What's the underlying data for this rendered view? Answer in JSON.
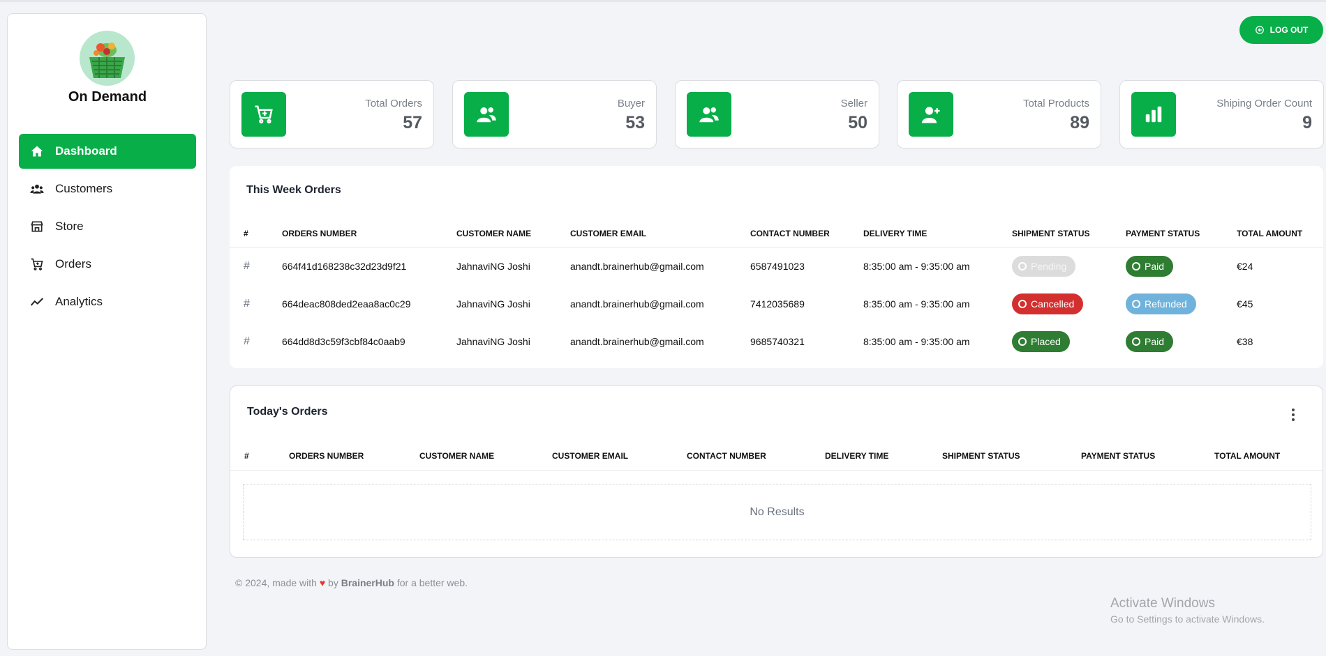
{
  "app": {
    "brand": "On Demand",
    "logout_label": "LOG OUT"
  },
  "colors": {
    "accent": "#08ae48",
    "pending": "#d9d9d9",
    "cancelled": "#d32f2f",
    "refunded": "#6fb3dc",
    "placed_paid": "#2e7d32"
  },
  "sidebar": {
    "items": [
      {
        "label": "Dashboard",
        "icon": "home-icon",
        "active": true
      },
      {
        "label": "Customers",
        "icon": "users-icon"
      },
      {
        "label": "Store",
        "icon": "store-icon"
      },
      {
        "label": "Orders",
        "icon": "cart-icon"
      },
      {
        "label": "Analytics",
        "icon": "trend-icon"
      }
    ]
  },
  "stats": [
    {
      "label": "Total Orders",
      "value": "57",
      "icon": "cart-plus-icon"
    },
    {
      "label": "Buyer",
      "value": "53",
      "icon": "users-icon"
    },
    {
      "label": "Seller",
      "value": "50",
      "icon": "users-icon"
    },
    {
      "label": "Total Products",
      "value": "89",
      "icon": "user-plus-icon"
    },
    {
      "label": "Shiping Order Count",
      "value": "9",
      "icon": "bar-chart-icon"
    }
  ],
  "week_orders": {
    "title": "This Week Orders",
    "columns": [
      "#",
      "ORDERS NUMBER",
      "CUSTOMER NAME",
      "CUSTOMER EMAIL",
      "CONTACT NUMBER",
      "DELIVERY TIME",
      "SHIPMENT STATUS",
      "PAYMENT STATUS",
      "TOTAL AMOUNT"
    ],
    "rows": [
      {
        "hash": "#",
        "order": "664f41d168238c32d23d9f21",
        "name": "JahnaviNG Joshi",
        "email": "anandt.brainerhub@gmail.com",
        "contact": "6587491023",
        "time": "8:35:00 am - 9:35:00 am",
        "shipment": "Pending",
        "payment": "Paid",
        "amount": "€24"
      },
      {
        "hash": "#",
        "order": "664deac808ded2eaa8ac0c29",
        "name": "JahnaviNG Joshi",
        "email": "anandt.brainerhub@gmail.com",
        "contact": "7412035689",
        "time": "8:35:00 am - 9:35:00 am",
        "shipment": "Cancelled",
        "payment": "Refunded",
        "amount": "€45"
      },
      {
        "hash": "#",
        "order": "664dd8d3c59f3cbf84c0aab9",
        "name": "JahnaviNG Joshi",
        "email": "anandt.brainerhub@gmail.com",
        "contact": "9685740321",
        "time": "8:35:00 am - 9:35:00 am",
        "shipment": "Placed",
        "payment": "Paid",
        "amount": "€38"
      }
    ]
  },
  "today_orders": {
    "title": "Today's Orders",
    "columns": [
      "#",
      "ORDERS NUMBER",
      "CUSTOMER NAME",
      "CUSTOMER EMAIL",
      "CONTACT NUMBER",
      "DELIVERY TIME",
      "SHIPMENT STATUS",
      "PAYMENT STATUS",
      "TOTAL AMOUNT"
    ],
    "empty_text": "No Results"
  },
  "footer": {
    "prefix": "© 2024, made with",
    "by": "by",
    "company": "BrainerHub",
    "suffix": "for a better web."
  },
  "watermark": {
    "title": "Activate Windows",
    "subtitle": "Go to Settings to activate Windows."
  }
}
